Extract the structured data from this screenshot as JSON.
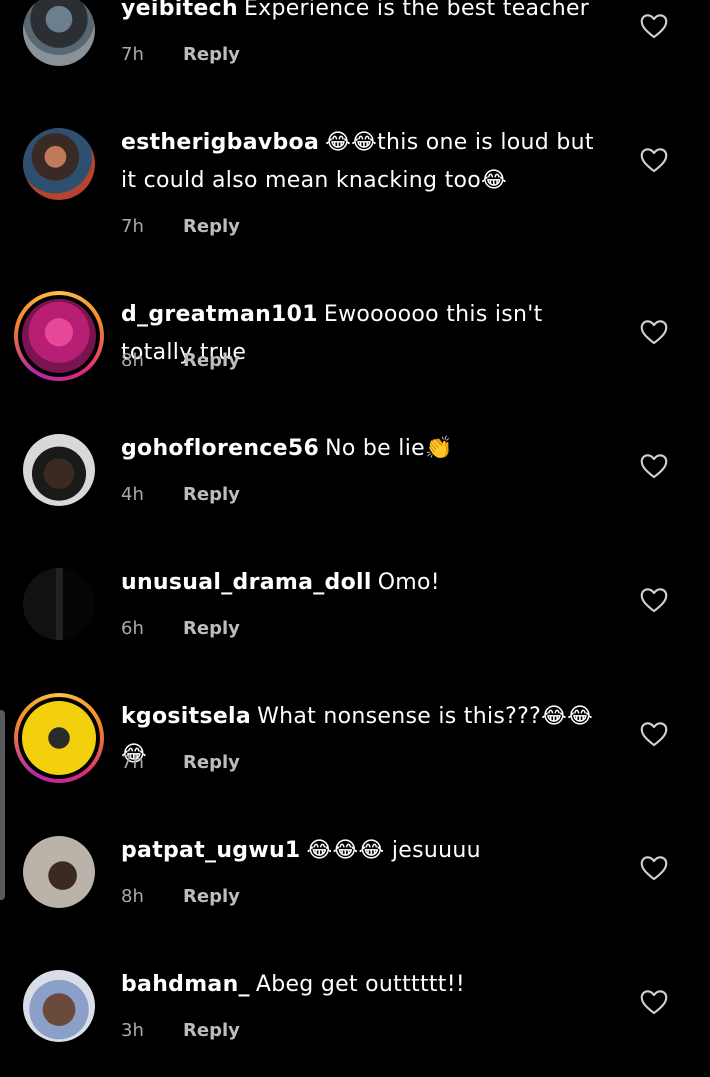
{
  "comments": [
    {
      "username": "yeibitech",
      "text": "Experience is the best teacher",
      "time": "7h",
      "reply_label": "Reply",
      "avatar_icon": "user-photo-avatar",
      "has_story_ring": false
    },
    {
      "username": "estherigbavboa",
      "text": "😂😂this one is loud but it could also mean knacking too😂",
      "time": "7h",
      "reply_label": "Reply",
      "avatar_icon": "user-photo-avatar",
      "has_story_ring": false
    },
    {
      "username": "d_greatman101",
      "text": "Ewoooooo this isn't totally true",
      "time": "8h",
      "reply_label": "Reply",
      "avatar_icon": "user-photo-avatar",
      "has_story_ring": true
    },
    {
      "username": "gohoflorence56",
      "text": "No be lie👏",
      "time": "4h",
      "reply_label": "Reply",
      "avatar_icon": "user-photo-avatar",
      "has_story_ring": false
    },
    {
      "username": "unusual_drama_doll",
      "text": "Omo!",
      "time": "6h",
      "reply_label": "Reply",
      "avatar_icon": "user-photo-avatar",
      "has_story_ring": false
    },
    {
      "username": "kgositsela",
      "text": "What nonsense is this???😂😂😂",
      "time": "7h",
      "reply_label": "Reply",
      "avatar_icon": "user-photo-avatar",
      "has_story_ring": true
    },
    {
      "username": "patpat_ugwu1",
      "text": "😂😂😂 jesuuuu",
      "time": "8h",
      "reply_label": "Reply",
      "avatar_icon": "user-photo-avatar",
      "has_story_ring": false
    },
    {
      "username": "bahdman_",
      "text": "Abeg get outttttt!!",
      "time": "3h",
      "reply_label": "Reply",
      "avatar_icon": "user-photo-avatar",
      "has_story_ring": false
    }
  ],
  "icons": {
    "like": "heart-outline-icon"
  },
  "colors": {
    "background": "#000000",
    "text": "#ffffff",
    "meta": "#aaaaaa",
    "story_ring_start": "#f9c146",
    "story_ring_end": "#dd2a7b"
  }
}
